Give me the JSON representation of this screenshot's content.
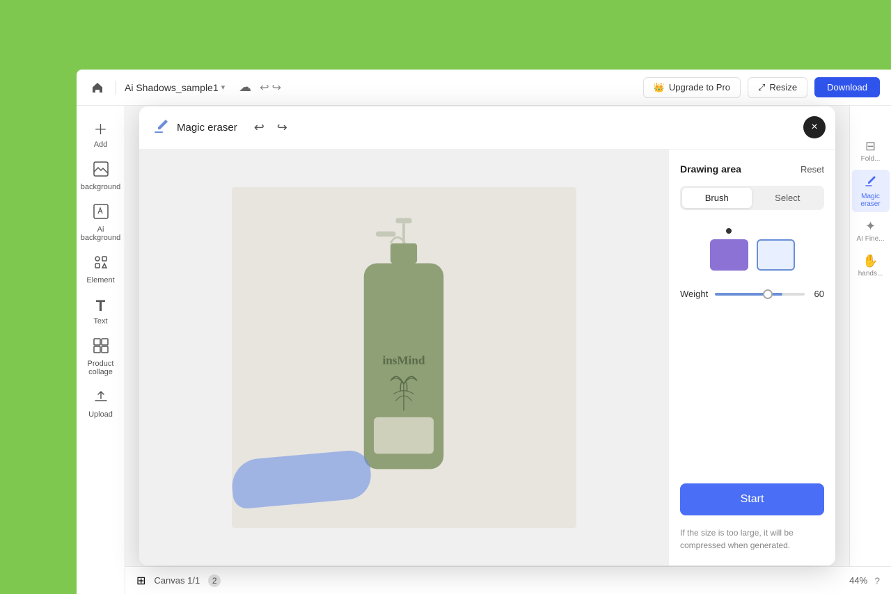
{
  "appWindow": {
    "topBar": {
      "homeIcon": "⌂",
      "fileName": "Ai Shadows_sample1",
      "fileNameChevron": "▾",
      "cloudIcon": "☁",
      "undoIcon": "↩",
      "redoIcon": "↪",
      "upgradeLabel": "Upgrade to Pro",
      "resizeLabel": "Resize",
      "downloadLabel": "Download"
    },
    "sidebar": {
      "items": [
        {
          "id": "add",
          "icon": "＋",
          "label": "Add"
        },
        {
          "id": "background",
          "icon": "▦",
          "label": "background"
        },
        {
          "id": "ai-background",
          "icon": "✦",
          "label": "Ai background"
        },
        {
          "id": "element",
          "icon": "◈",
          "label": "Element"
        },
        {
          "id": "text",
          "icon": "T",
          "label": "Text"
        },
        {
          "id": "product-collage",
          "icon": "⊞",
          "label": "Product collage"
        },
        {
          "id": "upload",
          "icon": "⬆",
          "label": "Upload"
        }
      ]
    },
    "rightPanel": {
      "items": [
        {
          "id": "layers",
          "icon": "⊟",
          "label": "Fold..."
        },
        {
          "id": "magic-eraser",
          "icon": "◈",
          "label": "Magic eraser",
          "active": true
        },
        {
          "id": "ai-fine",
          "icon": "✦",
          "label": "AI Fine..."
        },
        {
          "id": "hands",
          "icon": "✋",
          "label": "hands..."
        }
      ]
    },
    "bottomBar": {
      "layersIcon": "⊞",
      "canvasLabel": "Canvas 1/1",
      "layerCount": "2",
      "zoomLevel": "44%",
      "helpIcon": "?"
    }
  },
  "dialog": {
    "title": "Magic eraser",
    "closeButtonLabel": "×",
    "undoIcon": "↩",
    "redoIcon": "↪",
    "drawingArea": {
      "title": "Drawing area",
      "resetLabel": "Reset",
      "tabs": [
        {
          "id": "brush",
          "label": "Brush",
          "active": true
        },
        {
          "id": "select",
          "label": "Select",
          "active": false
        }
      ],
      "weight": {
        "label": "Weight",
        "value": 60,
        "min": 1,
        "max": 100
      }
    },
    "startButton": "Start",
    "footerNote": "If the size is too large, it will be compressed when generated."
  }
}
